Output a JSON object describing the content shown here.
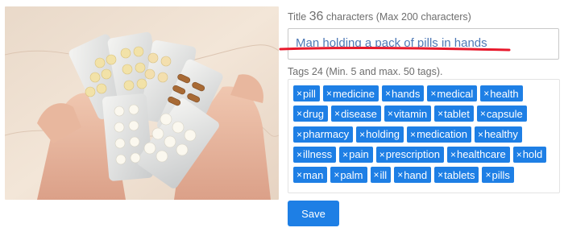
{
  "photo": {
    "alt_subject": "hands holding blister packs of pills"
  },
  "title": {
    "label": "Title",
    "count": "36",
    "count_suffix": "characters (Max 200 characters)",
    "value": "Man holding a pack of pills in hands"
  },
  "tags": {
    "label": "Tags 24 (Min. 5 and max. 50 tags).",
    "remove_glyph": "×",
    "rows": [
      [
        "pill",
        "medicine",
        "hands",
        "medical",
        "health"
      ],
      [
        "drug",
        "disease",
        "vitamin",
        "tablet",
        "capsule"
      ],
      [
        "pharmacy",
        "holding",
        "medication",
        "healthy"
      ],
      [
        "illness",
        "pain",
        "prescription",
        "healthcare",
        "hold"
      ],
      [
        "man",
        "palm",
        "ill",
        "hand",
        "tablets",
        "pills"
      ]
    ]
  },
  "save_label": "Save",
  "colors": {
    "accent": "#1e7fe5",
    "title_text": "#4e79b6",
    "underline": "#e8192c"
  }
}
